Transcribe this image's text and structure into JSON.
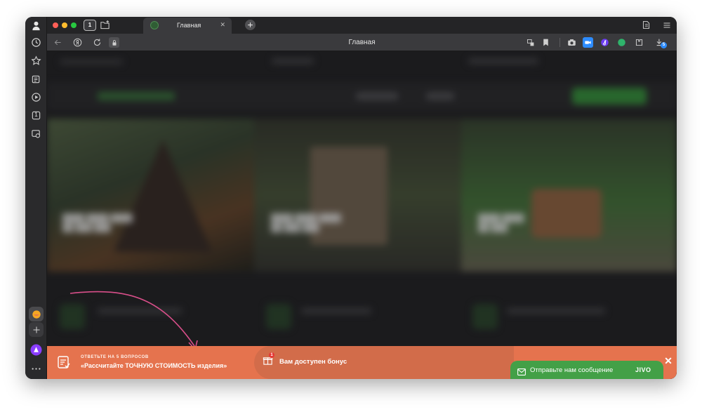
{
  "tab": {
    "title": "Главная",
    "tab_count": "1"
  },
  "address_bar": {
    "page_title": "Главная",
    "downloads_badge": "5"
  },
  "banner": {
    "quiz_subtitle": "ОТВЕТЬТЕ НА 5 ВОПРОСОВ",
    "quiz_title": "«Рассчитайте ТОЧНУЮ СТОИМОСТЬ изделия»",
    "bonus_text": "Вам доступен бонус",
    "bonus_badge": "1",
    "close_symbol": "✕"
  },
  "chat": {
    "label": "Отправьте нам сообщение",
    "brand": "JIVO"
  },
  "sidebar": {
    "tab_counter": "1"
  },
  "colors": {
    "banner_orange": "#e5734e",
    "chat_green": "#43a047",
    "accent_green": "#3a9a3f"
  }
}
